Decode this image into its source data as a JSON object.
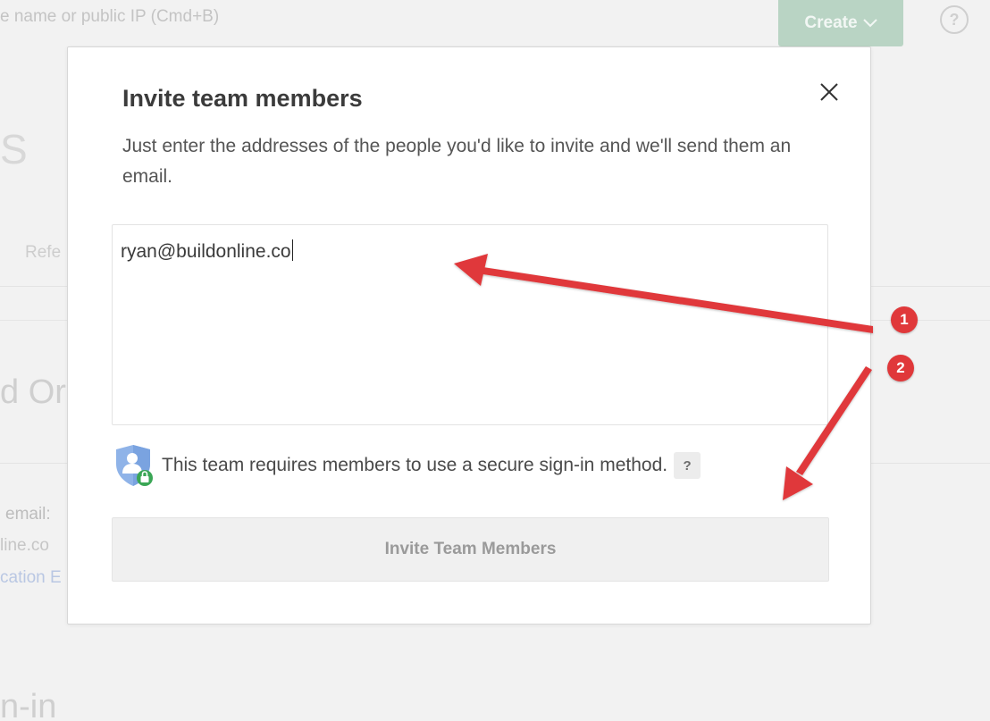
{
  "background": {
    "search_placeholder": "e name or public IP (Cmd+B)",
    "create_button": "Create",
    "help_icon": "?",
    "section_letter": "S",
    "tab_label": "Refe",
    "heading_fragment": "d Or",
    "email_label": "email:",
    "email_value": "line.co",
    "link_fragment": "cation E",
    "signin_fragment": "n-in"
  },
  "modal": {
    "title": "Invite team members",
    "description": "Just enter the addresses of the people you'd like to invite and we'll send them an email.",
    "email_input_value": "ryan@buildonline.co",
    "secure_notice": "This team requires members to use a secure sign-in method.",
    "help_badge": "?",
    "submit_button": "Invite Team Members"
  },
  "annotations": {
    "badge_1": "1",
    "badge_2": "2",
    "arrow_color": "#e0383a"
  },
  "colors": {
    "accent_green": "#b9d4c4",
    "annotation_red": "#e0383a"
  }
}
